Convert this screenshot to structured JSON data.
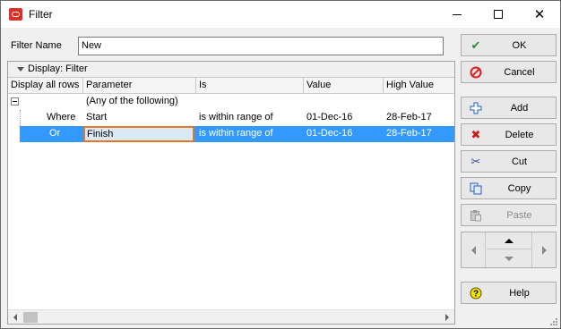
{
  "window": {
    "title": "Filter",
    "controls": {
      "minimize_icon": "minimize-icon",
      "maximize_icon": "maximize-icon",
      "close_icon": "close-icon"
    },
    "close_glyph": "✕"
  },
  "filter_name": {
    "label": "Filter Name",
    "value": "New"
  },
  "grid": {
    "group_label": "Display: Filter",
    "columns": [
      "Display all rows",
      "Parameter",
      "Is",
      "Value",
      "High Value"
    ],
    "rows": [
      {
        "param": "(Any of the following)",
        "is": "",
        "value": "",
        "high": "",
        "conj": ""
      },
      {
        "conj": "Where",
        "param": "Start",
        "is": "is within range of",
        "value": "01-Dec-16",
        "high": "28-Feb-17"
      },
      {
        "conj": "Or",
        "param": "Finish",
        "is": "is within range of",
        "value": "01-Dec-16",
        "high": "28-Feb-17",
        "selected": true
      }
    ]
  },
  "buttons": {
    "ok": {
      "label": "OK",
      "icon": "check-icon",
      "glyph": "✔",
      "color": "#2e8b2e"
    },
    "cancel": {
      "label": "Cancel",
      "icon": "no-entry-icon",
      "color": "#e02020"
    },
    "add": {
      "label": "Add",
      "icon": "plus-icon",
      "color": "#1e5fbf"
    },
    "delete": {
      "label": "Delete",
      "icon": "x-icon",
      "glyph": "✖",
      "color": "#d01818"
    },
    "cut": {
      "label": "Cut",
      "icon": "scissors-icon",
      "glyph": "✂",
      "color": "#3050a0"
    },
    "copy": {
      "label": "Copy",
      "icon": "copy-icon",
      "color": "#3060b0"
    },
    "paste": {
      "label": "Paste",
      "icon": "paste-icon",
      "disabled": true
    },
    "help": {
      "label": "Help",
      "icon": "help-icon",
      "glyph": "?",
      "color": "#e8d800"
    }
  },
  "colors": {
    "selection": "#3399ff",
    "edit_border": "#e07a2a",
    "app_icon": "#e03024"
  }
}
